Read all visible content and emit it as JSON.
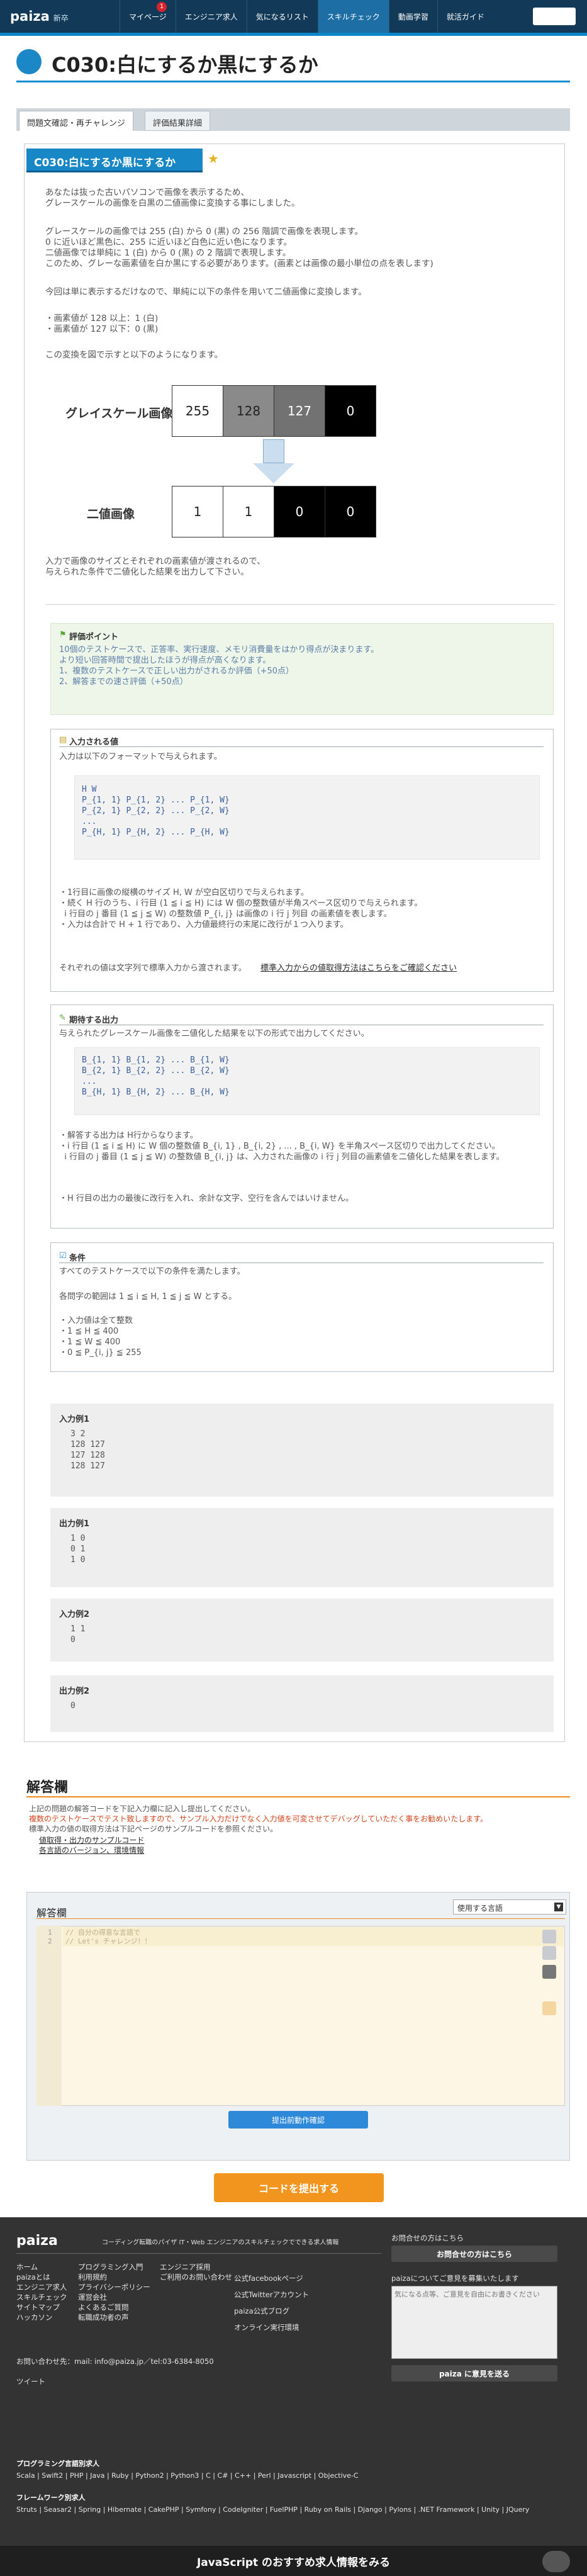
{
  "header": {
    "logo": "paiza",
    "logo_sub": "新卒",
    "nav": [
      "マイページ",
      "エンジニア求人",
      "気になるリスト",
      "スキルチェック",
      "動画学習",
      "就活ガイド"
    ],
    "badge": "1"
  },
  "page_title": "C030:白にするか黒にするか",
  "tabs": [
    "問題文確認・再チャレンジ",
    "評価結果詳細"
  ],
  "problem": {
    "bar_title": "C030:白にするか黒にするか",
    "intro": "あなたは抜った古いパソコンで画像を表示するため、\nグレースケールの画像を白黒の二値画像に変換する事にしました。",
    "para2": "グレースケールの画像では 255 (白) から 0 (黒) の 256 階調で画像を表現します。\n0 に近いほど黒色に、255 に近いほど白色に近い色になります。\n二値画像では単純に 1 (白) から 0 (黒) の 2 階調で表現します。\nこのため、グレーな画素値を白か黒にする必要があります。(画素とは画像の最小単位の点を表します)",
    "para3": "今回は単に表示するだけなので、単純に以下の条件を用いて二値画像に変換します。",
    "rules": "・画素値が 128 以上：1 (白)\n・画素値が 127 以下：0 (黒)",
    "para4": "この変換を図で示すと以下のようになります。",
    "gray_label": "グレイスケール画像",
    "gray_values": [
      "255",
      "128",
      "127",
      "0"
    ],
    "bin_label": "二値画像",
    "bin_values": [
      "1",
      "1",
      "0",
      "0"
    ],
    "para5": "入力で画像のサイズとそれぞれの画素値が渡されるので、\n与えられた条件で二値化した結果を出力して下さい。"
  },
  "eval": {
    "title": "評価ポイント",
    "text": "10個のテストケースで、正答率、実行速度、メモリ消費量をはかり得点が決まります。\nより短い回答時間で提出したほうが得点が高くなります。\n1、複数のテストケースで正しい出力がされるか評価（+50点）\n2、解答までの速さ評価（+50点）"
  },
  "input_sec": {
    "title": "入力される値",
    "desc": "入力は以下のフォーマットで与えられます。",
    "format": "H W\nP_{1, 1} P_{1, 2} ... P_{1, W}\nP_{2, 1} P_{2, 2} ... P_{2, W}\n...\nP_{H, 1} P_{H, 2} ... P_{H, W}",
    "notes": "・1行目に画像の縦横のサイズ H, W が空白区切りで与えられます。\n・続く H 行のうち、i 行目 (1 ≦ i ≦ H) には W 個の整数値が半角スペース区切りで与えられます。\n  i 行目の j 番目 (1 ≦ j ≦ W) の整数値 P_{i, j} は画像の i 行 j 列目 の画素値を表します。\n・入力は合計で H + 1 行であり、入力値最終行の末尾に改行が１つ入ります。",
    "stdin": "それぞれの値は文字列で標準入力から渡されます。",
    "stdin_link": "標準入力からの値取得方法はこちらをご確認ください"
  },
  "output_sec": {
    "title": "期待する出力",
    "desc": "与えられたグレースケール画像を二値化した結果を以下の形式で出力してください。",
    "format": "B_{1, 1} B_{1, 2} ... B_{1, W}\nB_{2, 1} B_{2, 2} ... B_{2, W}\n...\nB_{H, 1} B_{H, 2} ... B_{H, W}",
    "notes": "・解答する出力は H行からなります。\n・i 行目 (1 ≦ i ≦ H) に W 個の整数値 B_{i, 1} , B_{i, 2} , ... , B_{i, W} を半角スペース区切りで出力してください。\n  i 行目の j 番目 (1 ≦ j ≦ W) の整数値 B_{i, j} は、入力された画像の i 行 j 列目の画素値を二値化した結果を表します。",
    "final": "・H 行目の出力の最後に改行を入れ、余計な文字、空行を含んではいけません。"
  },
  "cond_sec": {
    "title": "条件",
    "desc": "すべてのテストケースで以下の条件を満たします。",
    "range": "各問字の範囲は 1 ≦ i ≦ H, 1 ≦ j ≦ W とする。",
    "list": "・入力値は全て整数\n・1 ≦ H ≦ 400\n・1 ≦ W ≦ 400\n・0 ≦ P_{i, j} ≦ 255"
  },
  "examples": [
    {
      "title": "入力例1",
      "body": "3 2\n128 127\n127 128\n128 127"
    },
    {
      "title": "出力例1",
      "body": "1 0\n0 1\n1 0"
    },
    {
      "title": "入力例2",
      "body": "1 1\n0"
    },
    {
      "title": "出力例2",
      "body": "0"
    }
  ],
  "answer": {
    "title": "解答欄",
    "note1": "上記の問題の解答コードを下記入力欄に記入し提出してください。",
    "note2": "複数のテストケースでテスト致しますので、サンプル入力だけでなく入力値を可変させてデバッグしていただく事をお勧めいたします。",
    "note3": "標準入力の値の取得方法は下記ページのサンプルコードを参照ください。",
    "link1": "値取得・出力のサンプルコード",
    "link2": "各言語のバージョン、環境情報",
    "editor_title": "解答欄",
    "lang_select": "使用する言語",
    "code_lines": [
      "// 自分の得意な言語で",
      "// Let's チャレンジ！！"
    ],
    "line_numbers": [
      "1",
      "2"
    ],
    "run_button": "提出前動作確認",
    "submit_button": "コードを提出する"
  },
  "footer": {
    "logo": "paiza",
    "tagline": "コーディング転職のパイザ IT・Web エンジニアのスキルチェックでできる求人情報",
    "col1": "ホーム\npaizaとは\nエンジニア求人\nスキルチェック\nサイトマップ\nハッカソン",
    "col2": "プログラミング入門\n利用規約\nプライバシーポリシー\n運営会社\nよくあるご質問\n転職成功者の声",
    "col3": "エンジニア採用\nご利用のお問い合わせ",
    "social": [
      "公式facebookページ",
      "公式Twitterアカウント",
      "paiza公式ブログ",
      "オンライン実行環境"
    ],
    "inquiry_title": "お問合せの方はこちら",
    "inquiry_button": "お問合せの方はこちら",
    "feedback_title": "paizaについてご意見を募集いたします",
    "feedback_placeholder": "気になる点等、ご意見を自由にお書きください",
    "feedback_button": "paiza に意見を送る",
    "contact": "お問い合わせ先：mail: info@paiza.jp／tel:03-6384-8050",
    "tweet": "ツイート",
    "lang_title": "プログラミング言語別求人",
    "langs": "Scala | Swift2 | PHP | Java | Ruby | Python2 | Python3 | C | C# | C++ | Perl | Javascript | Objective-C",
    "fw_title": "フレームワーク別求人",
    "fws": "Struts | Seasar2 | Spring | Hibernate | CakePHP | Symfony | CodeIgniter | FuelPHP | Ruby on Rails | Django | Pylons | .NET Framework | Unity | JQuery",
    "bottom": "JavaScript のおすすめ求人情報をみる"
  }
}
